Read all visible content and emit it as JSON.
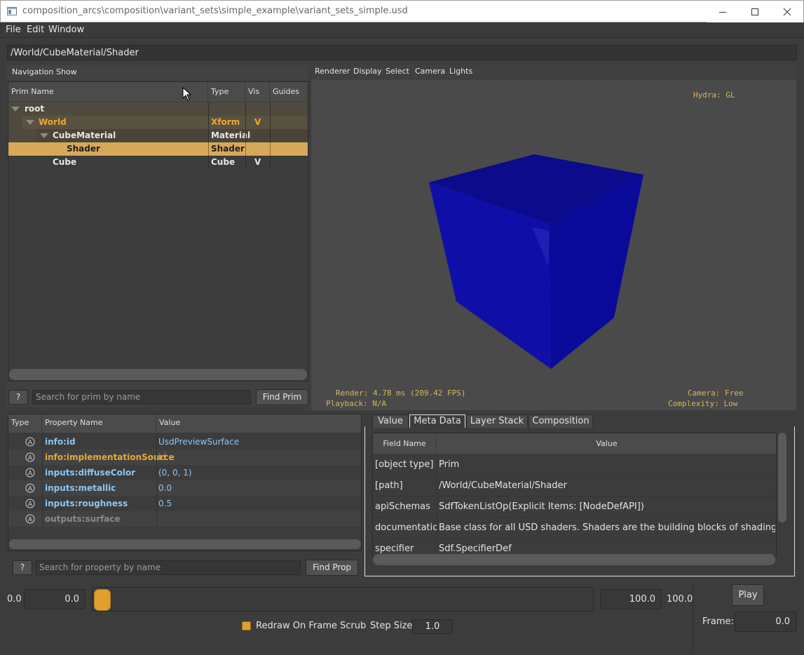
{
  "window": {
    "title": "composition_arcs\\composition\\variant_sets\\simple_example\\variant_sets_simple.usd"
  },
  "menu": [
    "File",
    "Edit",
    "Window"
  ],
  "path": "/World/CubeMaterial/Shader",
  "tree_toolbar": [
    "Navigation",
    "Show"
  ],
  "tree": {
    "headers": [
      "Prim Name",
      "Type",
      "Vis",
      "Guides"
    ],
    "rows": [
      {
        "name": "root",
        "type": "",
        "vis": ""
      },
      {
        "name": "World",
        "type": "Xform",
        "vis": "V"
      },
      {
        "name": "CubeMaterial",
        "type": "Material",
        "vis": ""
      },
      {
        "name": "Shader",
        "type": "Shader",
        "vis": ""
      },
      {
        "name": "Cube",
        "type": "Cube",
        "vis": "V"
      }
    ]
  },
  "prim_search": {
    "help": "?",
    "placeholder": "Search for prim by name",
    "button": "Find Prim"
  },
  "viewport": {
    "menu": [
      "Renderer",
      "Display",
      "Select",
      "Camera",
      "Lights"
    ],
    "renderer": "Hydra: GL",
    "render_stats": "Render: 4.78 ms (209.42 FPS)",
    "playback": "Playback: N/A",
    "camera": "Camera: Free",
    "complexity": "Complexity: Low",
    "cube_color": "#0b0ba0"
  },
  "properties": {
    "headers": [
      "Type",
      "Property Name",
      "Value"
    ],
    "rows": [
      {
        "name": "info:id",
        "value": "UsdPreviewSurface"
      },
      {
        "name": "info:implementationSource",
        "value": "id"
      },
      {
        "name": "inputs:diffuseColor",
        "value": "(0, 0, 1)"
      },
      {
        "name": "inputs:metallic",
        "value": "0.0"
      },
      {
        "name": "inputs:roughness",
        "value": "0.5"
      },
      {
        "name": "outputs:surface",
        "value": ""
      }
    ]
  },
  "prop_search": {
    "help": "?",
    "placeholder": "Search for property by name",
    "button": "Find Prop"
  },
  "tabs": [
    "Value",
    "Meta Data",
    "Layer Stack",
    "Composition"
  ],
  "metadata": {
    "headers": [
      "Field Name",
      "Value"
    ],
    "rows": [
      {
        "field": "[object type]",
        "value": "Prim"
      },
      {
        "field": "[path]",
        "value": "/World/CubeMaterial/Shader"
      },
      {
        "field": "apiSchemas",
        "value": "SdfTokenListOp(Explicit Items: [NodeDefAPI])"
      },
      {
        "field": "documentation",
        "value": "Base class for all USD shaders. Shaders are the building blocks of shading ..."
      },
      {
        "field": "specifier",
        "value": "Sdf.SpecifierDef"
      }
    ]
  },
  "timeline": {
    "start_label": "0.0",
    "start_value": "0.0",
    "end_value": "100.0",
    "end_label": "100.0",
    "redraw_label": "Redraw On Frame Scrub",
    "step_label": "Step Size",
    "step_value": "1.0",
    "play": "Play",
    "frame_label": "Frame:",
    "frame_value": "0.0"
  }
}
